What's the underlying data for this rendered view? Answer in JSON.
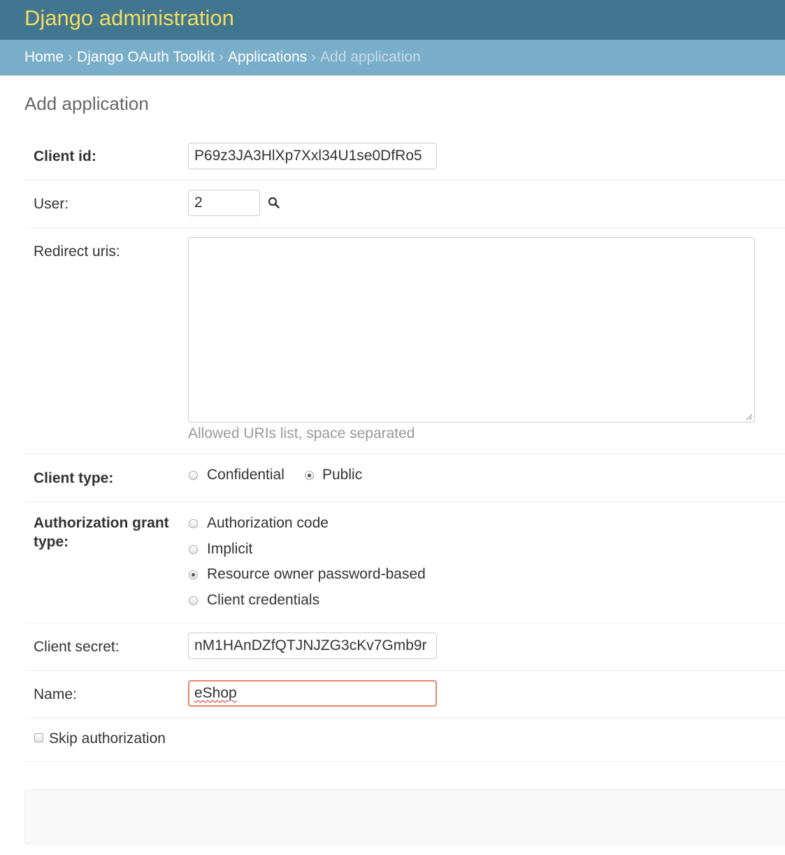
{
  "header": {
    "site_name": "Django administration"
  },
  "breadcrumbs": {
    "items": [
      "Home",
      "Django OAuth Toolkit",
      "Applications"
    ],
    "separator": "›",
    "current": "Add application"
  },
  "page": {
    "title": "Add application"
  },
  "form": {
    "client_id": {
      "label": "Client id:",
      "value": "P69z3JA3HlXp7Xxl34U1se0DfRo5"
    },
    "user": {
      "label": "User:",
      "value": "2",
      "lookup_icon": "search-icon"
    },
    "redirect_uris": {
      "label": "Redirect uris:",
      "value": "",
      "help": "Allowed URIs list, space separated"
    },
    "client_type": {
      "label": "Client type:",
      "options": [
        "Confidential",
        "Public"
      ],
      "selected": "Public"
    },
    "grant_type": {
      "label_line1": "Authorization grant",
      "label_line2": "type:",
      "options": [
        "Authorization code",
        "Implicit",
        "Resource owner password-based",
        "Client credentials"
      ],
      "selected": "Resource owner password-based"
    },
    "client_secret": {
      "label": "Client secret:",
      "value": "nM1HAnDZfQTJNJZG3cKv7Gmb9r"
    },
    "name": {
      "label": "Name:",
      "value": "eShop"
    },
    "skip_authorization": {
      "label": "Skip authorization",
      "checked": false
    }
  },
  "colors": {
    "header_bg": "#417690",
    "site_name": "#f5dd5d",
    "breadcrumbs_bg": "#79aec8",
    "focus_border": "#e5876b"
  }
}
